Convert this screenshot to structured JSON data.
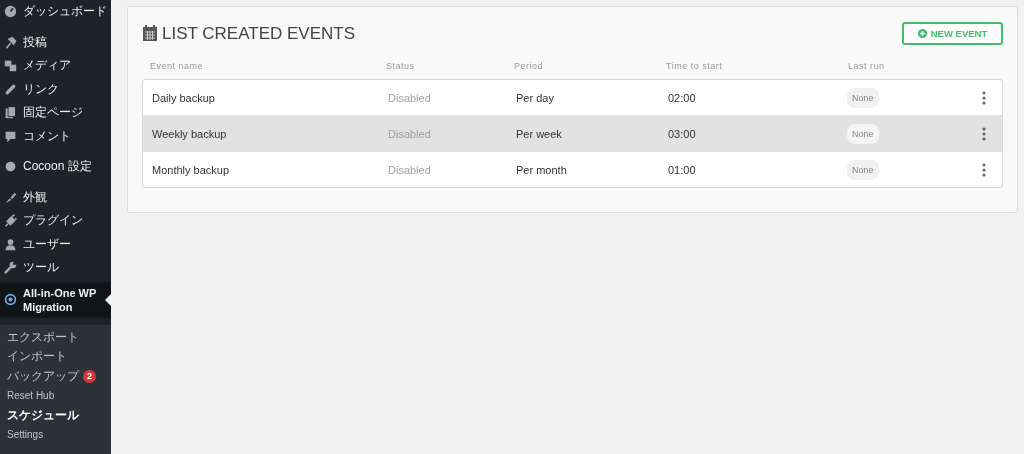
{
  "sidebar": {
    "groups": [
      [
        {
          "label": "ダッシュボード"
        }
      ],
      [
        {
          "label": "投稿"
        },
        {
          "label": "メディア"
        },
        {
          "label": "リンク"
        },
        {
          "label": "固定ページ"
        },
        {
          "label": "コメント"
        }
      ],
      [
        {
          "label": "Cocoon 設定"
        }
      ],
      [
        {
          "label": "外観"
        },
        {
          "label": "プラグイン"
        },
        {
          "label": "ユーザー"
        },
        {
          "label": "ツール"
        },
        {
          "label": "All-in-One WP Migration",
          "selected": true
        }
      ]
    ],
    "submenu": [
      {
        "label": "エクスポート",
        "selected": false
      },
      {
        "label": "インポート",
        "selected": false
      },
      {
        "label": "バックアップ",
        "selected": false,
        "badge": "2"
      },
      {
        "label": "Reset Hub",
        "selected": false
      },
      {
        "label": "スケジュール",
        "selected": true
      },
      {
        "label": "Settings",
        "selected": false
      }
    ]
  },
  "panel": {
    "title": "LIST CREATED EVENTS",
    "button": "NEW EVENT",
    "columns": [
      "Event name",
      "Status",
      "Period",
      "Time to start",
      "Last run"
    ],
    "rows": [
      {
        "name": "Daily backup",
        "status": "Disabled",
        "period": "Per day",
        "time": "02:00",
        "last_run": "None",
        "selected": false
      },
      {
        "name": "Weekly backup",
        "status": "Disabled",
        "period": "Per week",
        "time": "03:00",
        "last_run": "None",
        "selected": true
      },
      {
        "name": "Monthly backup",
        "status": "Disabled",
        "period": "Per month",
        "time": "01:00",
        "last_run": "None",
        "selected": false
      }
    ]
  }
}
